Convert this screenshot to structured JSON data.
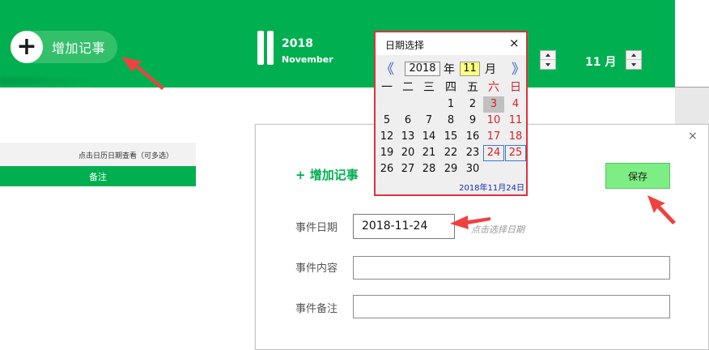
{
  "header": {
    "add_button_label": "增加记事",
    "year": "2018",
    "month_name": "November",
    "month_label": "11 月"
  },
  "left_panel": {
    "hint": "点击日历日期查看（可多选）",
    "note_header": "备注"
  },
  "dialog": {
    "close": "×",
    "title": "+ 增加记事",
    "save_label": "保存",
    "date_label": "事件日期",
    "date_value": "2018-11-24",
    "date_hint": "点击选择日期",
    "content_label": "事件内容",
    "content_value": "",
    "remark_label": "事件备注",
    "remark_value": ""
  },
  "calendar": {
    "title": "日期选择",
    "close": "×",
    "prev": "《",
    "next": "》",
    "year": "2018",
    "year_suffix": "年",
    "month": "11",
    "month_suffix": "月",
    "weekdays": [
      "一",
      "二",
      "三",
      "四",
      "五",
      "六",
      "日"
    ],
    "rows": [
      [
        "",
        "",
        "",
        "1",
        "2",
        "3",
        "4"
      ],
      [
        "5",
        "6",
        "7",
        "8",
        "9",
        "10",
        "11"
      ],
      [
        "12",
        "13",
        "14",
        "15",
        "16",
        "17",
        "18"
      ],
      [
        "19",
        "20",
        "21",
        "22",
        "23",
        "24",
        "25"
      ],
      [
        "26",
        "27",
        "28",
        "29",
        "30",
        "",
        ""
      ]
    ],
    "selected_day": "3",
    "boxed_days": [
      "24",
      "25"
    ],
    "footer": "2018年11月24日"
  },
  "colors": {
    "brand_green": "#00b050",
    "accent_red": "#e0313c",
    "nav_blue": "#2f5fc9"
  }
}
